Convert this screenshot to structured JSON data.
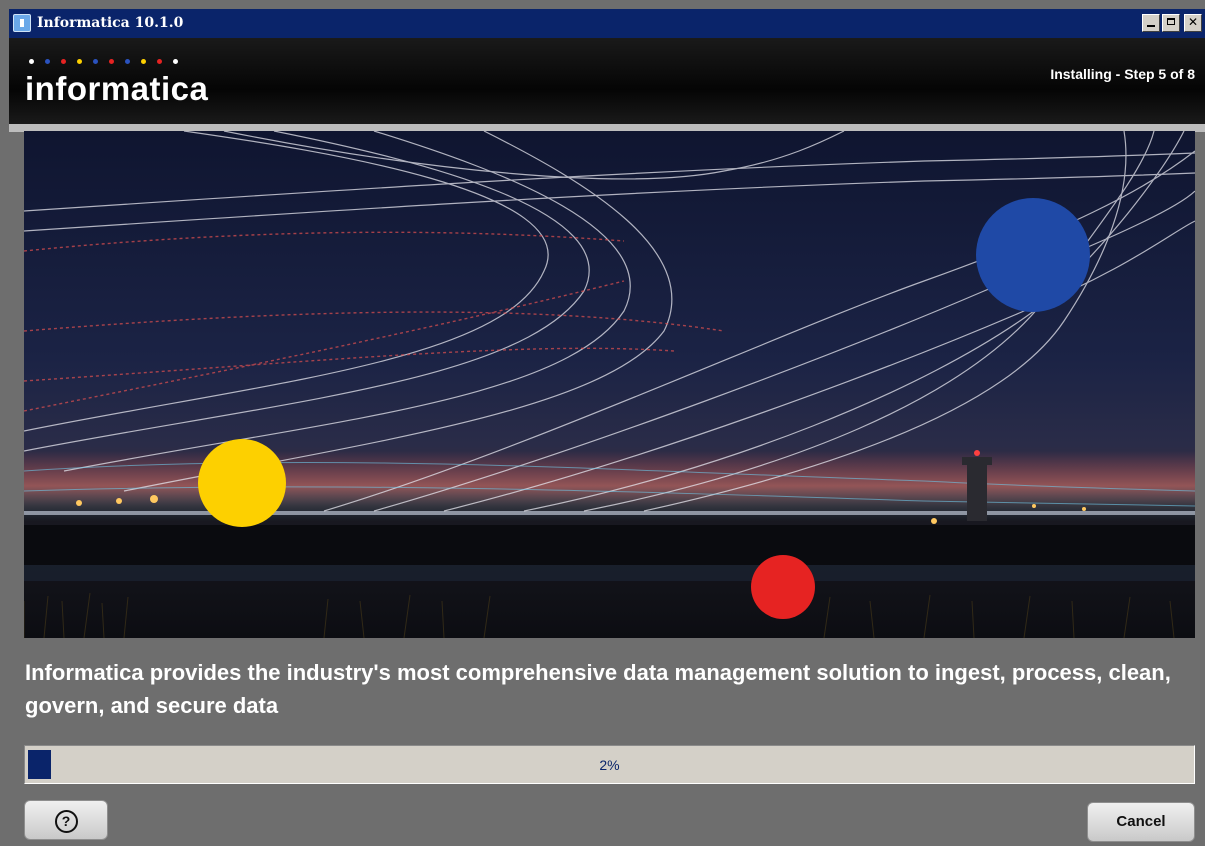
{
  "window": {
    "title": "Informatica 10.1.0"
  },
  "header": {
    "logo_text": "informatica",
    "step_label": "Installing - Step 5 of 8",
    "logo_dot_colors": [
      "#ffffff",
      "#2a52be",
      "#e62322",
      "#fdd000",
      "#2a52be",
      "#e62322",
      "#2a52be",
      "#fdd000",
      "#e62322",
      "#ffffff"
    ]
  },
  "banner": {
    "circle_colors": {
      "blue": "#1f49a6",
      "yellow": "#fdd000",
      "red": "#e62322"
    }
  },
  "tagline": "Informatica provides the industry's most comprehensive data management solution to ingest, process, clean, govern, and secure data",
  "progress": {
    "value": 0.02,
    "label": "2%"
  },
  "buttons": {
    "help_icon": "question-circle-icon",
    "help_glyph": "?",
    "cancel_label": "Cancel"
  },
  "colors": {
    "titlebar": "#0a246a",
    "progress_fill": "#0a246a"
  }
}
